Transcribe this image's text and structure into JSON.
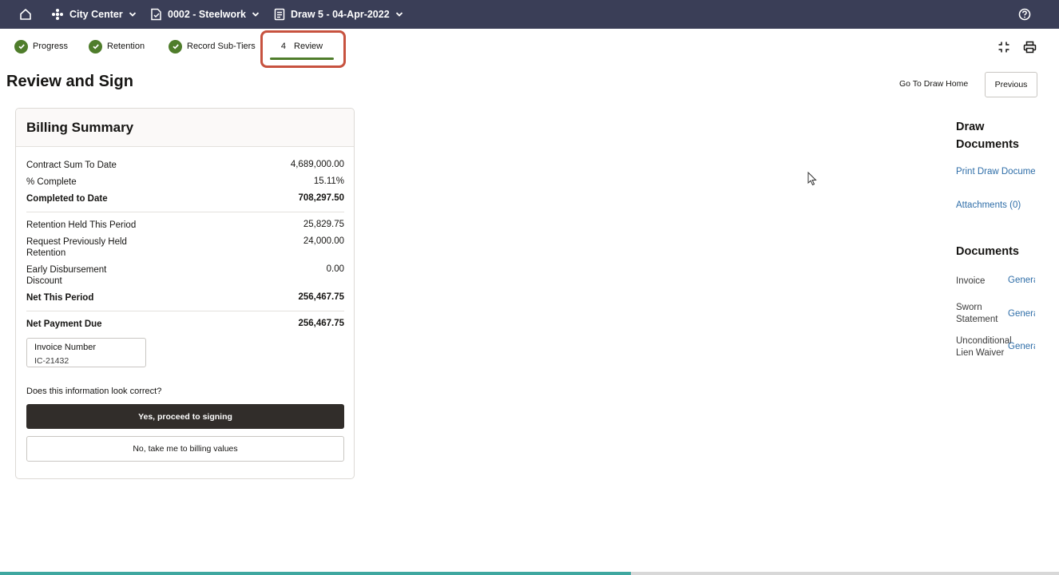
{
  "topbar": {
    "project": "City Center",
    "contract": "0002 - Steelwork",
    "draw": "Draw 5 - 04-Apr-2022",
    "bg_color": "#3a3e57"
  },
  "tabs": [
    {
      "label": "Progress",
      "status": "complete"
    },
    {
      "label": "Retention",
      "status": "complete"
    },
    {
      "label": "Record Sub-Tiers",
      "status": "complete"
    },
    {
      "number": "4",
      "label": "Review",
      "status": "current"
    }
  ],
  "page": {
    "title": "Review and Sign",
    "go_home_label": "Go To Draw Home",
    "previous_label": "Previous"
  },
  "billing": {
    "title": "Billing Summary",
    "rows": [
      {
        "label": "Contract Sum To Date",
        "value": "4,689,000.00"
      },
      {
        "label": "% Complete",
        "value": "15.11%"
      },
      {
        "label": "Completed to Date",
        "value": "708,297.50"
      },
      {
        "label": "Retention Held This Period",
        "value": "25,829.75"
      },
      {
        "label": "Request Previously Held Retention",
        "value": "24,000.00"
      },
      {
        "label": "Early Disbursement Discount",
        "value": "0.00"
      },
      {
        "label": "Net This Period",
        "value": "256,467.75"
      },
      {
        "label": "Net Payment Due",
        "value": "256,467.75"
      }
    ],
    "invoice_label": "Invoice Number",
    "invoice_value": "IC-21432",
    "question": "Does this information look correct?",
    "yes_label": "Yes, proceed to signing",
    "no_label": "No, take me to billing values"
  },
  "right_panel": {
    "draw_documents_heading": "Draw Documents",
    "print_link": "Print Draw Documents",
    "attachments_link": "Attachments (0)",
    "documents_heading": "Documents",
    "documents": [
      {
        "name": "Invoice",
        "action": "Generate"
      },
      {
        "name": "Sworn Statement",
        "action": "Generate"
      },
      {
        "name": "Unconditional Lien Waiver",
        "action": "Generate"
      }
    ]
  },
  "colors": {
    "accent_green": "#4f7d2b",
    "highlight_red": "#c7523f",
    "link_blue": "#2f6ea8",
    "primary_button": "#312d2a"
  }
}
